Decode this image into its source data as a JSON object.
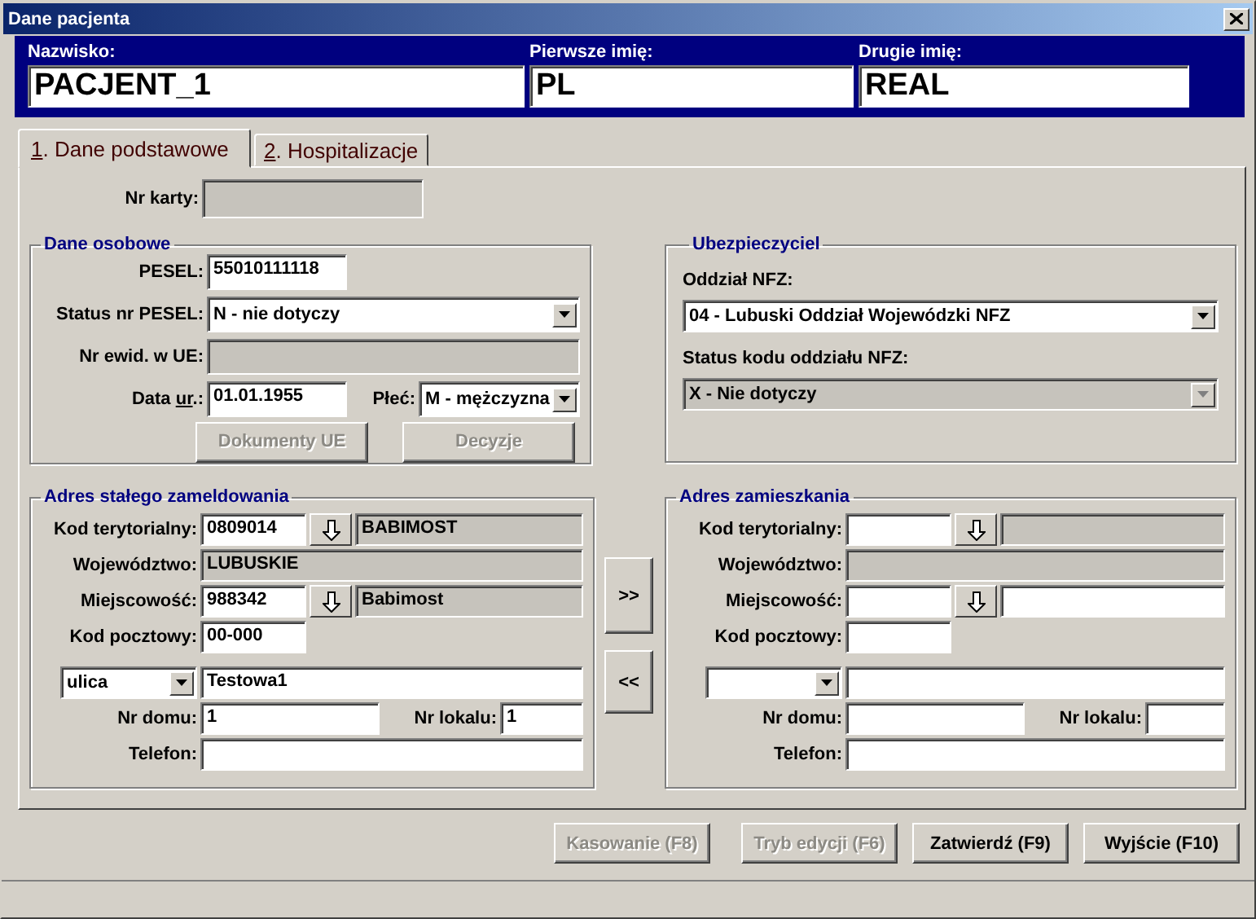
{
  "window": {
    "title": "Dane pacjenta"
  },
  "header": [
    {
      "label": "Nazwisko:",
      "value": "PACJENT_1"
    },
    {
      "label": "Pierwsze imię:",
      "value": "PL"
    },
    {
      "label": "Drugie imię:",
      "value": "REAL"
    }
  ],
  "tabs": [
    {
      "label": [
        {
          "text": "1",
          "underline": true
        },
        {
          "text": ". Dane podstawowe",
          "underline": false
        }
      ],
      "selected": true
    },
    {
      "label": [
        {
          "text": "2",
          "underline": true
        },
        {
          "text": ". Hospitalizacje",
          "underline": false
        }
      ],
      "selected": false
    }
  ],
  "card_number": {
    "label": "Nr karty:",
    "disabled": true
  },
  "personal": {
    "title": "Dane osobowe",
    "pesel": {
      "label": "PESEL:",
      "value": "55010111118"
    },
    "pesel_status": {
      "label": "Status nr PESEL:",
      "value": "N - nie dotyczy",
      "disabled": false
    },
    "eu_number": {
      "label": "Nr ewid. w UE:",
      "disabled": true
    },
    "birth_date": {
      "label": [
        {
          "text": "Data ",
          "underline": false
        },
        {
          "text": "ur",
          "underline": true
        },
        {
          "text": ".:",
          "underline": false
        }
      ],
      "value": "01.01.1955"
    },
    "sex": {
      "label": "Płeć:",
      "value": "M - mężczyzna",
      "disabled": false
    },
    "buttons": [
      {
        "label": "Dokumenty UE",
        "disabled": true
      },
      {
        "label": "Decyzje",
        "disabled": true
      }
    ]
  },
  "insurer": {
    "title": "Ubezpieczyciel",
    "branch": {
      "label": "Oddział NFZ:",
      "value": "04 - Lubuski Oddział Wojewódzki NFZ",
      "disabled": false
    },
    "branch_status": {
      "label": "Status kodu oddziału NFZ:",
      "value": "X - Nie dotyczy",
      "disabled": true
    }
  },
  "addresses": [
    {
      "title": "Adres stałego zameldowania",
      "territory": {
        "label": "Kod terytorialny:",
        "code": {
          "value": "0809014"
        },
        "name": {
          "value": "BABIMOST",
          "disabled": true
        }
      },
      "province": {
        "label": "Województwo:",
        "value": "LUBUSKIE",
        "disabled": true
      },
      "locality": {
        "label": "Miejscowość:",
        "code": {
          "value": "988342"
        },
        "name": {
          "value": "Babimost",
          "disabled": true
        }
      },
      "postal": {
        "label": "Kod pocztowy:",
        "value": "00-000"
      },
      "street_type": {
        "value": "ulica",
        "disabled": false
      },
      "street": {
        "value": "Testowa1"
      },
      "house": {
        "label": "Nr domu:",
        "value": "1"
      },
      "flat": {
        "label": "Nr lokalu:",
        "value": "1"
      },
      "phone": {
        "label": "Telefon:"
      }
    },
    {
      "title": "Adres zamieszkania",
      "territory": {
        "label": "Kod terytorialny:",
        "name": {
          "disabled": true
        }
      },
      "province": {
        "label": "Województwo:",
        "disabled": true
      },
      "locality": {
        "label": "Miejscowość:",
        "name": {
          "disabled": false
        }
      },
      "postal": {
        "label": "Kod pocztowy:"
      },
      "street_type": {
        "disabled": false
      },
      "house": {
        "label": "Nr domu:"
      },
      "flat": {
        "label": "Nr lokalu:"
      },
      "phone": {
        "label": "Telefon:"
      }
    }
  ],
  "copy_buttons": [
    ">>",
    "<<"
  ],
  "footer_buttons": [
    {
      "label": "Kasowanie (F8)",
      "disabled": true
    },
    {
      "label": "Tryb edycji (F6)",
      "disabled": true
    },
    {
      "label": "Zatwierdź (F9)",
      "disabled": false
    },
    {
      "label": "Wyjście (F10)",
      "disabled": false
    }
  ]
}
